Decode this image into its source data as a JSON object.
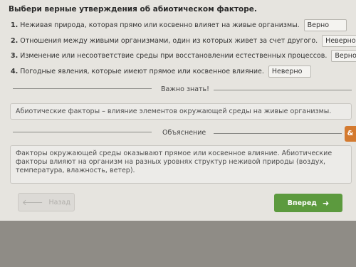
{
  "title": "Выбери верные утверждения об абиотическом факторе.",
  "statements": [
    {
      "num": "1.",
      "text": "Неживая природа, которая прямо или косвенно влияет на живые организмы.",
      "answer": "Верно"
    },
    {
      "num": "2.",
      "text": "Отношения между живыми организмами, один из которых живет за счет другого.",
      "answer": "Неверно"
    },
    {
      "num": "3.",
      "text": "Изменение или несоответствие среды при восстановлении естественных процессов.",
      "answer": "Верно"
    },
    {
      "num": "4.",
      "text": "Погодные явления, которые имеют прямое или косвенное влияние.",
      "answer": "Неверно"
    }
  ],
  "important": {
    "label": "Важно знать!",
    "text": "Абиотические факторы – влияние элементов окружающей среды на живые организмы."
  },
  "explanation": {
    "label": "Объяснение",
    "text": "Факторы окружающей среды оказывают прямое или косвенное влияние. Абиотические факторы влияют на организм на разных уровнях структур неживой природы (воздух, температура, влажность, ветер)."
  },
  "nav": {
    "back_label": "Назад",
    "next_label": "Вперед",
    "back_arrow": "🡐",
    "next_arrow": "➜"
  },
  "side_tab_glyph": "&"
}
